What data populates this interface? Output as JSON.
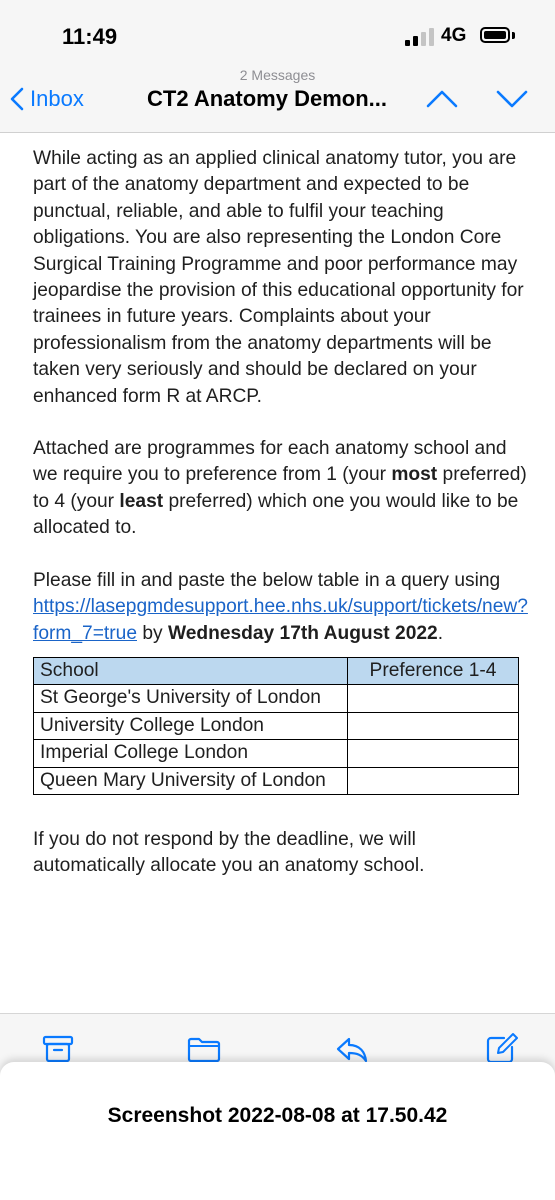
{
  "status_bar": {
    "time": "11:49",
    "network": "4G"
  },
  "nav": {
    "message_count": "2 Messages",
    "back_label": "Inbox",
    "title": "CT2 Anatomy Demon..."
  },
  "email": {
    "paragraph1": "While acting as an applied clinical anatomy tutor, you are part of the anatomy department and expected to be punctual, reliable, and able to fulfil your teaching obligations.  You are also representing the London Core Surgical Training Programme and poor performance may jeopardise the provision of this educational opportunity for trainees in future years.  Complaints about your professionalism from the anatomy departments will be taken very seriously and should be declared on your enhanced form R at ARCP.",
    "p2_a": "Attached are programmes for each anatomy school and we require you to preference from 1 (your ",
    "p2_most": "most",
    "p2_b": " preferred) to 4 (your ",
    "p2_least": "least",
    "p2_c": " preferred) which one you would like to be allocated to.",
    "p3_a": "Please fill in and paste the below table in a query using ",
    "p3_link": "https://lasepgmdesupport.hee.nhs.uk/support/tickets/new?form_7=true",
    "p3_b": " by ",
    "p3_deadline": "Wednesday 17th August 2022",
    "p3_c": ".",
    "table": {
      "header_school": "School",
      "header_pref": "Preference 1-4",
      "rows": [
        {
          "school": "St George's University of London",
          "preference": ""
        },
        {
          "school": "University College London",
          "preference": ""
        },
        {
          "school": "Imperial College London",
          "preference": ""
        },
        {
          "school": "Queen Mary University of London",
          "preference": ""
        }
      ]
    },
    "paragraph4": "If you do not respond by the deadline, we will automatically allocate you an anatomy school."
  },
  "toolbar": {
    "icons": [
      "archive-icon",
      "folder-icon",
      "reply-icon",
      "compose-icon"
    ]
  },
  "caption": "Screenshot 2022-08-08 at 17.50.42",
  "colors": {
    "accent": "#0a7aff",
    "link": "#1a64c8",
    "table_header": "#bcd8ef"
  }
}
